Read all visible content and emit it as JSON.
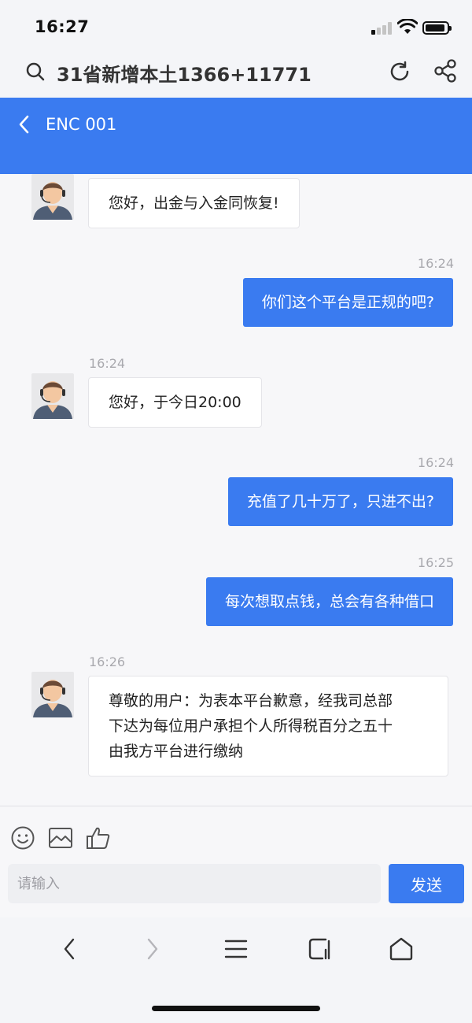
{
  "status_bar": {
    "time": "16:27"
  },
  "browser": {
    "search_text": "31省新增本土1366+11771"
  },
  "header": {
    "title": "ENC 001"
  },
  "messages": [
    {
      "from": "agent",
      "time": "",
      "text": "您好，出金与入金同恢复!"
    },
    {
      "from": "user",
      "time": "16:24",
      "text": "你们这个平台是正规的吧?"
    },
    {
      "from": "agent",
      "time": "16:24",
      "text": "您好，于今日20:00"
    },
    {
      "from": "user",
      "time": "16:24",
      "text": "充值了几十万了，只进不出?"
    },
    {
      "from": "user",
      "time": "16:25",
      "text": "每次想取点钱，总会有各种借口"
    },
    {
      "from": "agent",
      "time": "16:26",
      "lines": [
        "尊敬的用户：为表本平台歉意，经我司总部",
        "下达为每位用户承担个人所得税百分之五十",
        "由我方平台进行缴纳"
      ]
    }
  ],
  "input": {
    "placeholder": "请输入",
    "value": "",
    "send_label": "发送"
  },
  "colors": {
    "accent": "#3a7bf0",
    "background": "#f7f7f9"
  },
  "icons": [
    "search-icon",
    "refresh-icon",
    "share-icon",
    "back-icon",
    "emoji-icon",
    "image-icon",
    "thumbs-up-icon",
    "nav-back-icon",
    "nav-forward-icon",
    "menu-icon",
    "tabs-icon",
    "home-icon"
  ]
}
